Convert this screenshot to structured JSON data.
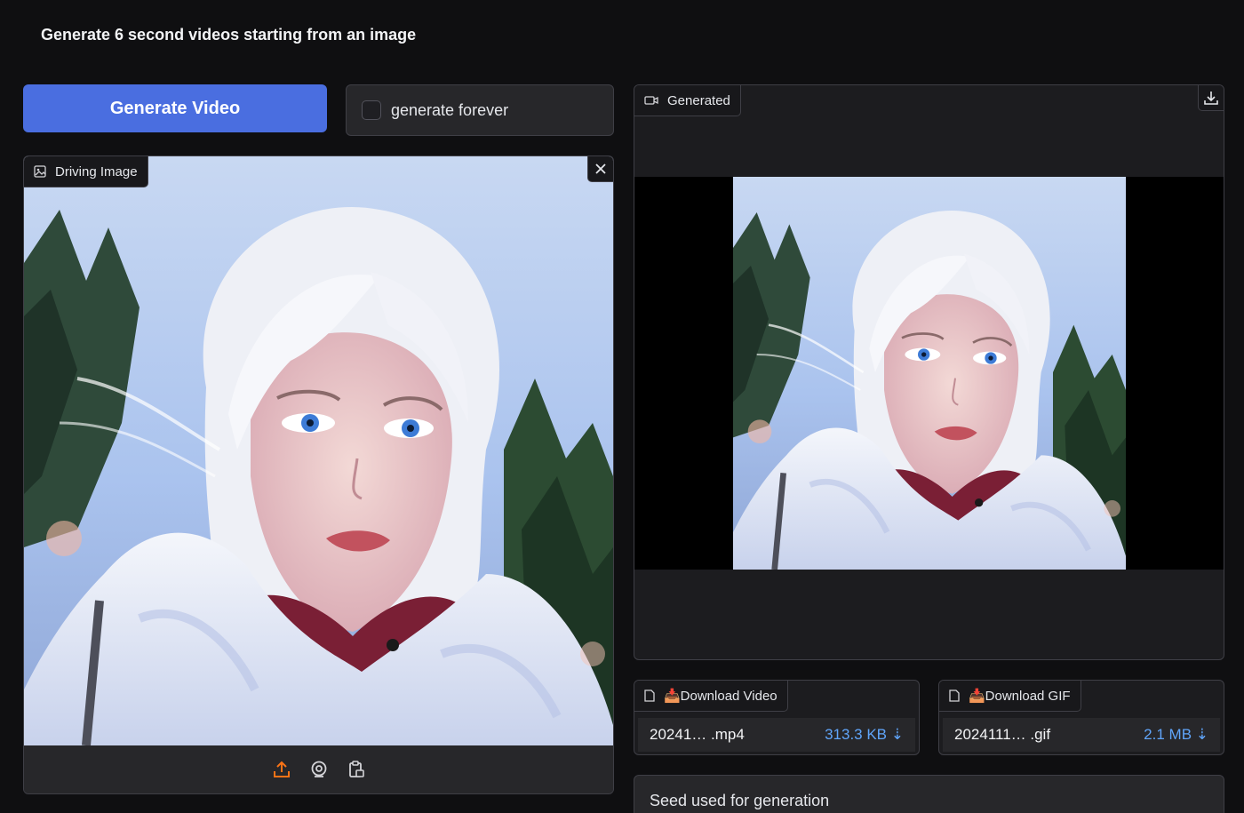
{
  "heading": "Generate 6 second videos starting from an image",
  "generate_button": "Generate Video",
  "forever_checkbox": {
    "label": "generate forever",
    "checked": false
  },
  "driving_image": {
    "label": "Driving Image",
    "footer_icons": [
      "upload-icon",
      "webcam-icon",
      "clipboard-icon"
    ]
  },
  "generated": {
    "label": "Generated"
  },
  "download_video": {
    "label": "📥Download Video",
    "file_name": "20241… .mp4",
    "file_size": "313.3 KB ⇣"
  },
  "download_gif": {
    "label": "📥Download GIF",
    "file_name": "2024111… .gif",
    "file_size": "2.1 MB ⇣"
  },
  "seed": {
    "label": "Seed used for generation"
  },
  "colors": {
    "accent": "#4a6ee0",
    "upload_icon": "#f97316",
    "link": "#60a5fa"
  }
}
